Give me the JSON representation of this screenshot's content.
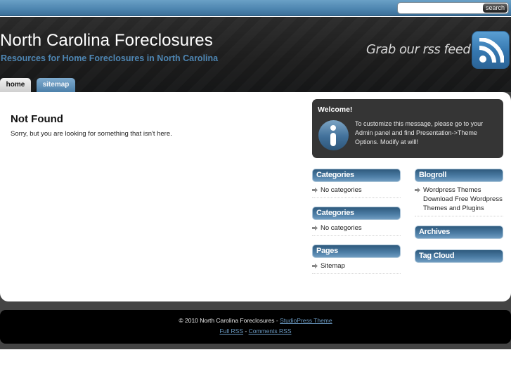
{
  "topbar": {
    "search_placeholder": "",
    "search_button_label": "search"
  },
  "header": {
    "site_title": "North Carolina Foreclosures",
    "tagline": "Resources for Home Foreclosures in North Carolina",
    "rss_text": "Grab our rss feed",
    "rss_icon": "rss-feed-icon"
  },
  "nav": {
    "tabs": [
      {
        "label": "home",
        "active": true
      },
      {
        "label": "sitemap",
        "active": false
      }
    ]
  },
  "main": {
    "title": "Not Found",
    "message": "Sorry, but you are looking for something that isn't here."
  },
  "sidebar": {
    "welcome": {
      "title": "Welcome!",
      "icon": "info-icon",
      "text": "To customize this message, please go to your Admin panel and find Presentation->Theme Options. Modify at will!"
    },
    "left_widgets": [
      {
        "title": "Categories",
        "items": [
          "No categories"
        ]
      },
      {
        "title": "Categories",
        "items": [
          "No categories"
        ]
      },
      {
        "title": "Pages",
        "items": [
          "Sitemap"
        ]
      }
    ],
    "right_widgets": [
      {
        "title": "Blogroll",
        "items": [
          "Wordpress Themes Download Free Wordpress Themes and Plugins"
        ]
      },
      {
        "title": "Archives",
        "items": []
      },
      {
        "title": "Tag Cloud",
        "items": []
      }
    ]
  },
  "footer": {
    "copyright": "© 2010 North Carolina Foreclosures - ",
    "theme_link": "StudioPress Theme",
    "full_rss": "Full RSS",
    "separator": " - ",
    "comments_rss": "Comments RSS"
  },
  "colors": {
    "accent_blue": "#4e86b3",
    "link_blue": "#6b9ac2",
    "header_dark": "#1c1c1c",
    "welcome_bg": "#353535"
  }
}
